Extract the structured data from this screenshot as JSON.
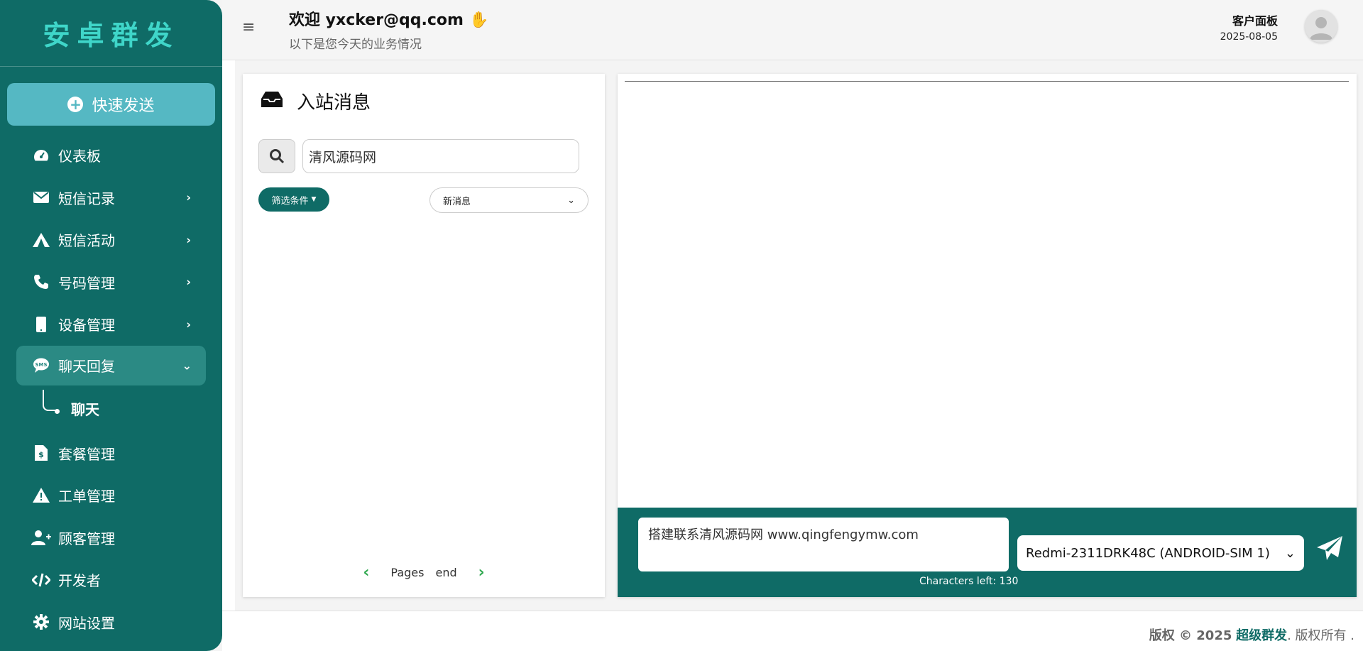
{
  "sidebar": {
    "brand": "安卓群发",
    "quick_send": "快速发送",
    "items": [
      {
        "label": "仪表板",
        "icon": "dashboard-icon",
        "has_chevron": false
      },
      {
        "label": "短信记录",
        "icon": "envelope-icon",
        "has_chevron": true
      },
      {
        "label": "短信活动",
        "icon": "campaign-icon",
        "has_chevron": true
      },
      {
        "label": "号码管理",
        "icon": "phone-icon",
        "has_chevron": true
      },
      {
        "label": "设备管理",
        "icon": "mobile-icon",
        "has_chevron": true
      },
      {
        "label": "聊天回复",
        "icon": "sms-chat-icon",
        "has_chevron": true,
        "active": true
      },
      {
        "label": "套餐管理",
        "icon": "plan-doc-icon",
        "has_chevron": false
      },
      {
        "label": "工单管理",
        "icon": "warning-icon",
        "has_chevron": false
      },
      {
        "label": "顾客管理",
        "icon": "user-plus-icon",
        "has_chevron": false
      },
      {
        "label": "开发者",
        "icon": "code-icon",
        "has_chevron": false
      },
      {
        "label": "网站设置",
        "icon": "gear-icon",
        "has_chevron": false
      }
    ],
    "sub_item": "聊天"
  },
  "header": {
    "welcome": "欢迎 yxcker@qq.com",
    "subtitle": "以下是您今天的业务情况",
    "panel_title": "客户面板",
    "date": "2025-08-05"
  },
  "inbox": {
    "title": "入站消息",
    "search_value": "清风源码网",
    "filter_label": "筛选条件",
    "select_value": "新消息",
    "pages_label": "Pages",
    "pages_value": "end"
  },
  "chat": {
    "message": "搭建联系清风源码网  www.qingfengymw.com",
    "chars_left": "Characters left: 130",
    "device": "Redmi-2311DRK48C (ANDROID-SIM 1)"
  },
  "footer": {
    "prefix": "版权 © 2025",
    "brand": "超级群发",
    "suffix": ". 版权所有 ."
  },
  "colors": {
    "primary": "#0f6b66",
    "accent": "#55b8c3",
    "brand_text": "#3fd6c9",
    "pager_arrow": "#2fa84f"
  }
}
